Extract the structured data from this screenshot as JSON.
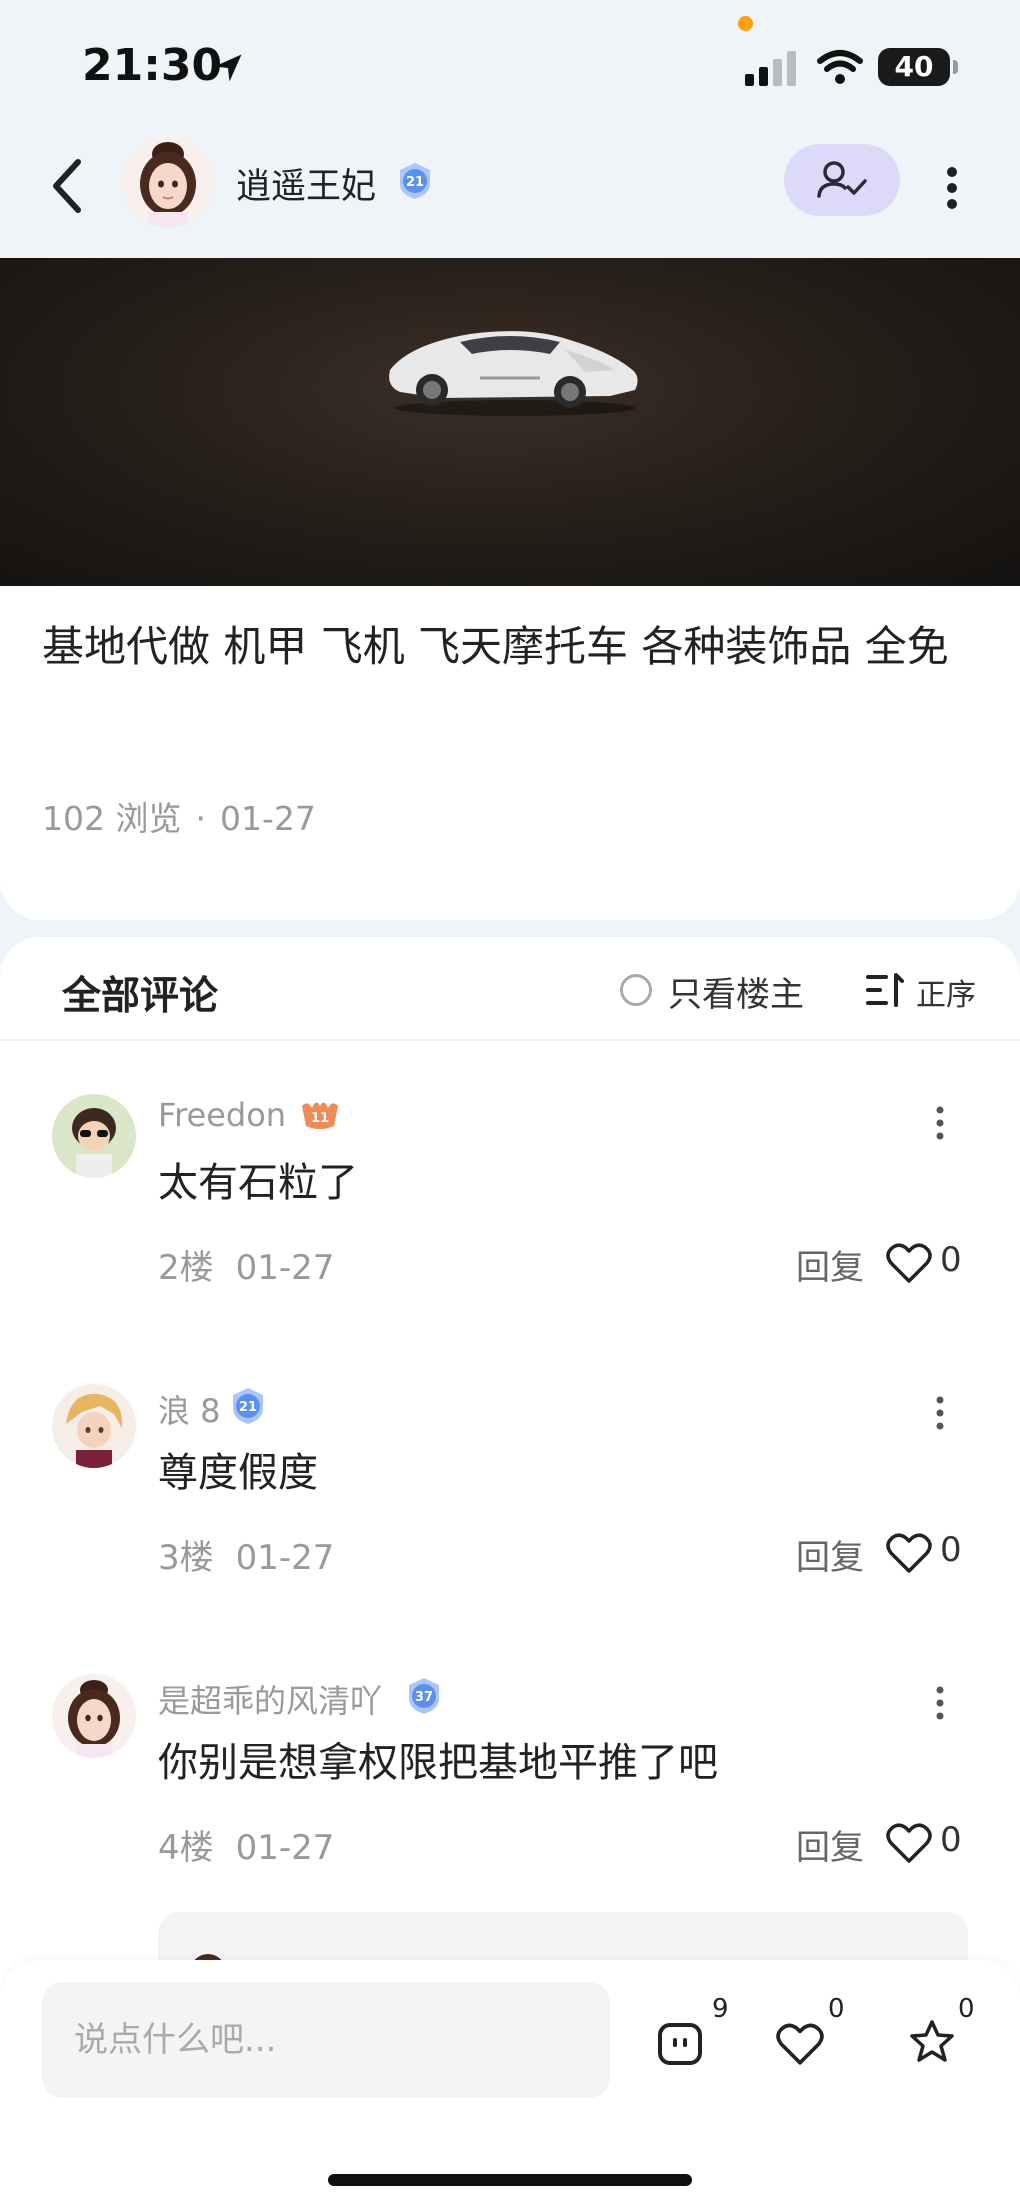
{
  "status_bar": {
    "time": "21:30",
    "battery": "40"
  },
  "header": {
    "author_name": "逍遥王妃",
    "level_badge": "21"
  },
  "post": {
    "title": "基地代做 机甲 飞机 飞天摩托车 各种装饰品 全免",
    "views": "102 浏览",
    "date": "01-27"
  },
  "comments_header": {
    "label": "全部评论",
    "owner_only": "只看楼主",
    "sort": "正序"
  },
  "comments": [
    {
      "user": "Freedon",
      "level": "11",
      "text": "太有石粒了",
      "floor": "2楼",
      "date": "01-27",
      "reply": "回复",
      "likes": "0"
    },
    {
      "user": "浪 8",
      "level": "21",
      "text": "尊度假度",
      "floor": "3楼",
      "date": "01-27",
      "reply": "回复",
      "likes": "0"
    },
    {
      "user": "是超乖的风清吖",
      "level": "37",
      "text": "你别是想拿权限把基地平推了吧",
      "floor": "4楼",
      "date": "01-27",
      "reply": "回复",
      "likes": "0"
    }
  ],
  "bottom_bar": {
    "placeholder": "说点什么吧...",
    "comment_count": "9",
    "like_count": "0",
    "favorite_count": "0"
  },
  "colors": {
    "accent": "#ddd9f8",
    "badge_blue": "#5b8ff0",
    "badge_orange": "#f28a55",
    "muted": "#999999"
  },
  "icons": [
    "back-icon",
    "location-arrow-icon",
    "signal-icon",
    "wifi-icon",
    "follow-icon",
    "more-icon",
    "sort-icon",
    "heart-icon",
    "comment-icon",
    "star-icon"
  ]
}
